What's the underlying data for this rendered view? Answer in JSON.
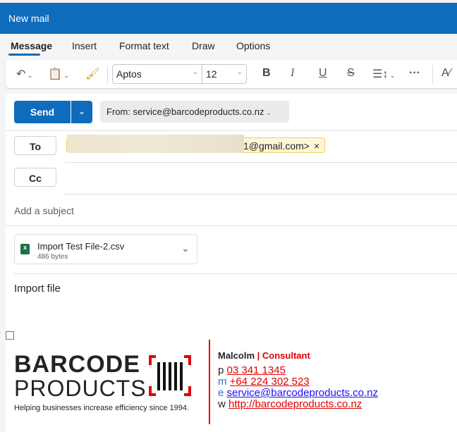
{
  "window": {
    "title": "New mail"
  },
  "tabs": [
    {
      "label": "Message",
      "active": true
    },
    {
      "label": "Insert"
    },
    {
      "label": "Format text"
    },
    {
      "label": "Draw"
    },
    {
      "label": "Options"
    }
  ],
  "toolbar": {
    "font": "Aptos",
    "size": "12"
  },
  "compose": {
    "send_label": "Send",
    "from": "From: service@barcodeproducts.co.nz",
    "to_label": "To",
    "cc_label": "Cc",
    "recipient": "1@gmail.com>",
    "subject_placeholder": "Add a subject"
  },
  "attachment": {
    "name": "Import Test File-2.csv",
    "size": "486 bytes"
  },
  "body": {
    "text": "Import file"
  },
  "signature": {
    "logo_line1": "BARCODE",
    "logo_line2": "PRODUCTS",
    "tagline": "Helping businesses increase efficiency since 1994.",
    "name": "Malcolm",
    "sep": " | ",
    "role": "Consultant",
    "p_label": "p",
    "phone": "03 341 1345",
    "m_label": "m",
    "mobile": "+64 224 302 523",
    "e_label": "e",
    "email": "service@barcodeproducts.co.nz",
    "w_label": "w",
    "website": "http://barcodeproducts.co.nz"
  },
  "colors": {
    "brand": "#0f6cbd",
    "accent_red": "#e00000"
  }
}
